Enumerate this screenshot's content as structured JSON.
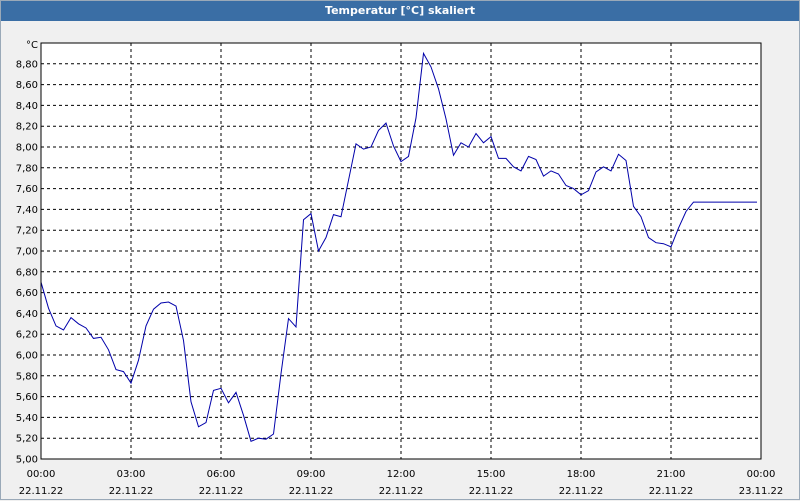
{
  "window": {
    "title": "Temperatur [°C] skaliert"
  },
  "colors": {
    "line": "#0000aa",
    "grid": "#000000",
    "plot_bg": "#ffffff",
    "titlebar": "#3a6ea5"
  },
  "chart_data": {
    "type": "line",
    "title": "Temperatur [°C] skaliert",
    "ylabel": "°C",
    "xlabel": "",
    "ylim": [
      5.0,
      9.0
    ],
    "xlim": [
      0,
      24
    ],
    "grid": true,
    "y_ticks": [
      "5,00",
      "5,20",
      "5,40",
      "5,60",
      "5,80",
      "6,00",
      "6,20",
      "6,40",
      "6,60",
      "6,80",
      "7,00",
      "7,20",
      "7,40",
      "7,60",
      "7,80",
      "8,00",
      "8,20",
      "8,40",
      "8,60",
      "8,80"
    ],
    "x_ticks": [
      {
        "time": "00:00",
        "date": "22.11.22"
      },
      {
        "time": "03:00",
        "date": "22.11.22"
      },
      {
        "time": "06:00",
        "date": "22.11.22"
      },
      {
        "time": "09:00",
        "date": "22.11.22"
      },
      {
        "time": "12:00",
        "date": "22.11.22"
      },
      {
        "time": "15:00",
        "date": "22.11.22"
      },
      {
        "time": "18:00",
        "date": "22.11.22"
      },
      {
        "time": "21:00",
        "date": "22.11.22"
      },
      {
        "time": "00:00",
        "date": "23.11.22"
      }
    ],
    "series": [
      {
        "x": [
          0.0,
          0.25,
          0.5,
          0.75,
          1.0,
          1.25,
          1.5,
          1.75,
          2.0,
          2.25,
          2.5,
          2.75,
          3.0,
          3.25,
          3.5,
          3.75,
          4.0,
          4.25,
          4.5,
          4.75,
          5.0,
          5.25,
          5.5,
          5.75,
          6.0,
          6.25,
          6.5,
          6.75,
          7.0,
          7.25,
          7.5,
          7.75,
          8.0,
          8.25,
          8.5,
          8.75,
          9.0,
          9.25,
          9.5,
          9.75,
          10.0,
          10.25,
          10.5,
          10.75,
          11.0,
          11.25,
          11.5,
          11.75,
          12.0,
          12.25,
          12.5,
          12.75,
          13.0,
          13.25,
          13.5,
          13.75,
          14.0,
          14.25,
          14.5,
          14.75,
          15.0,
          15.25,
          15.5,
          15.75,
          16.0,
          16.25,
          16.5,
          16.75,
          17.0,
          17.25,
          17.5,
          17.75,
          18.0,
          18.25,
          18.5,
          18.75,
          19.0,
          19.25,
          19.5,
          19.75,
          20.0,
          20.25,
          20.5,
          20.75,
          21.0,
          21.25,
          21.5,
          21.75,
          22.0,
          22.25,
          22.5,
          22.75,
          23.0,
          23.25,
          23.5,
          23.75,
          24.0,
          24.25,
          24.5
        ],
        "values": [
          6.7,
          6.45,
          6.28,
          6.24,
          6.36,
          6.3,
          6.26,
          6.16,
          6.17,
          6.05,
          5.86,
          5.84,
          5.73,
          5.95,
          6.28,
          6.44,
          6.5,
          6.51,
          6.47,
          6.14,
          5.55,
          5.31,
          5.35,
          5.66,
          5.68,
          5.54,
          5.64,
          5.42,
          5.17,
          5.2,
          5.19,
          5.24,
          5.82,
          6.35,
          6.27,
          7.3,
          7.36,
          7.0,
          7.13,
          7.35,
          7.33,
          7.68,
          8.03,
          7.98,
          8.0,
          8.16,
          8.23,
          8.01,
          7.86,
          7.91,
          8.28,
          8.9,
          8.77,
          8.56,
          8.27,
          7.92,
          8.04,
          8.0,
          8.13,
          8.04,
          8.1,
          7.89,
          7.89,
          7.81,
          7.77,
          7.91,
          7.88,
          7.72,
          7.77,
          7.74,
          7.63,
          7.6,
          7.54,
          7.58,
          7.76,
          7.81,
          7.77,
          7.93,
          7.87,
          7.43,
          7.33,
          7.13,
          7.08,
          7.07,
          7.04,
          7.22,
          7.38,
          7.47,
          7.47,
          7.47,
          7.47,
          7.47,
          7.47,
          7.47,
          7.47,
          7.47,
          7.47,
          7.47,
          7.47
        ]
      }
    ]
  }
}
